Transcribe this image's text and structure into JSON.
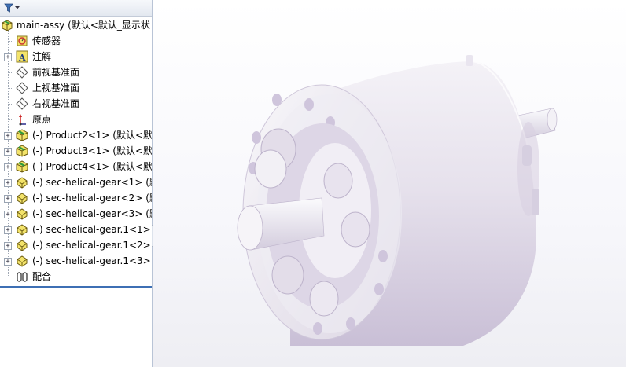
{
  "app": {
    "accent": "#3d6fb4"
  },
  "tree": {
    "filter_icon": "filter-icon",
    "items": [
      {
        "label": "main-assy  (默认<默认_显示状",
        "icon": "assembly-icon",
        "expand": "−",
        "level": 0
      },
      {
        "label": "传感器",
        "icon": "sensor-icon",
        "expand": "",
        "level": 1
      },
      {
        "label": "注解",
        "icon": "annotation-icon",
        "expand": "+",
        "level": 1
      },
      {
        "label": "前视基准面",
        "icon": "plane-icon",
        "expand": "",
        "level": 1
      },
      {
        "label": "上视基准面",
        "icon": "plane-icon",
        "expand": "",
        "level": 1
      },
      {
        "label": "右视基准面",
        "icon": "plane-icon",
        "expand": "",
        "level": 1
      },
      {
        "label": "原点",
        "icon": "origin-icon",
        "expand": "",
        "level": 1
      },
      {
        "label": "(-) Product2<1> (默认<默认",
        "icon": "subassembly-icon",
        "expand": "+",
        "level": 1
      },
      {
        "label": "(-) Product3<1> (默认<默认",
        "icon": "subassembly-icon",
        "expand": "+",
        "level": 1
      },
      {
        "label": "(-) Product4<1> (默认<默认",
        "icon": "subassembly-icon",
        "expand": "+",
        "level": 1
      },
      {
        "label": "(-) sec-helical-gear<1> (默",
        "icon": "part-icon",
        "expand": "+",
        "level": 1
      },
      {
        "label": "(-) sec-helical-gear<2> (默",
        "icon": "part-icon",
        "expand": "+",
        "level": 1
      },
      {
        "label": "(-) sec-helical-gear<3> (默",
        "icon": "part-icon",
        "expand": "+",
        "level": 1
      },
      {
        "label": "(-) sec-helical-gear.1<1> (",
        "icon": "part-icon",
        "expand": "+",
        "level": 1
      },
      {
        "label": "(-) sec-helical-gear.1<2> (",
        "icon": "part-icon",
        "expand": "+",
        "level": 1
      },
      {
        "label": "(-) sec-helical-gear.1<3> (",
        "icon": "part-icon",
        "expand": "+",
        "level": 1
      },
      {
        "label": "配合",
        "icon": "mates-icon",
        "expand": "",
        "level": 1
      }
    ]
  },
  "model": {
    "color": "#e8e4ee",
    "shade": "#c9bfd6"
  }
}
